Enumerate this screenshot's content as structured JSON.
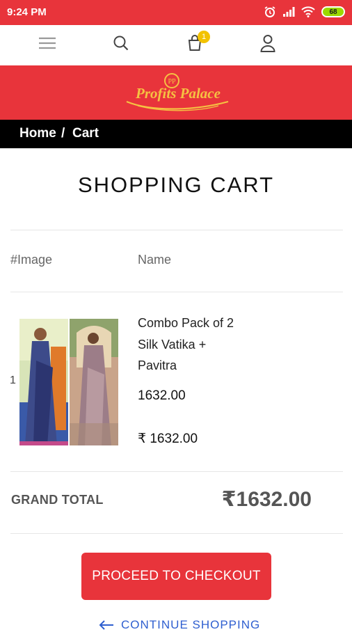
{
  "status_bar": {
    "time": "9:24 PM",
    "battery": "68"
  },
  "nav": {
    "cart_count": "1"
  },
  "brand": {
    "logo_text": "Profits Palace",
    "logo_monogram": "PP"
  },
  "breadcrumb": {
    "home": "Home",
    "separator": "/",
    "current": "Cart"
  },
  "page": {
    "title": "SHOPPING CART"
  },
  "cart_table": {
    "headers": {
      "image": "#Image",
      "name": "Name"
    },
    "items": [
      {
        "index": "1",
        "name": "Combo Pack of 2 Silk Vatika + Pavitra",
        "price": "1632.00",
        "subtotal": "₹ 1632.00"
      }
    ]
  },
  "totals": {
    "label": "GRAND TOTAL",
    "value": "₹1632.00"
  },
  "actions": {
    "checkout": "PROCEED TO CHECKOUT",
    "continue": "CONTINUE SHOPPING"
  },
  "colors": {
    "brand_red": "#e8343b",
    "gold": "#f2c200",
    "link_blue": "#2f5fd0"
  }
}
